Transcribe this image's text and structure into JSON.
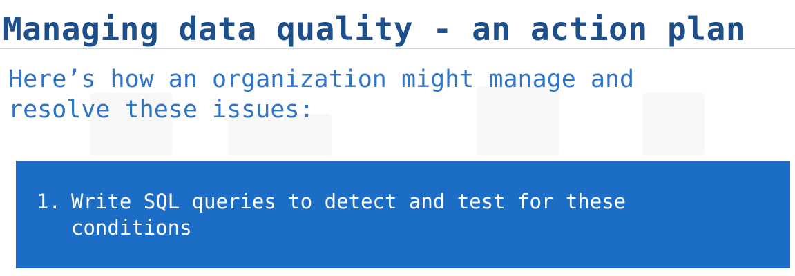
{
  "slide": {
    "title": "Managing data quality - an action plan",
    "subtitle_lines": [
      "Here’s how an organization might manage and",
      "resolve these issues:"
    ],
    "steps": [
      {
        "number": "1.",
        "text": "Write SQL queries to detect and test for these conditions"
      }
    ]
  },
  "colors": {
    "title": "#1d4f8a",
    "subtitle": "#2e74c9",
    "box_background": "#1c6dc5",
    "box_text": "#ffffff",
    "rule": "#c9d3df"
  }
}
